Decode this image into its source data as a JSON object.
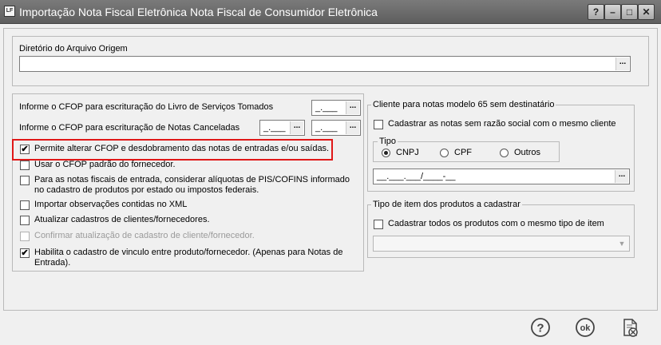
{
  "window": {
    "icon_label": "LF",
    "title": "Importação Nota Fiscal Eletrônica Nota Fiscal de Consumidor Eletrônica",
    "help_btn": "?",
    "minimize": "–",
    "maximize": "□",
    "close": "✕"
  },
  "origin": {
    "label": "Diretório do Arquivo Origem",
    "value": "",
    "browse": "..."
  },
  "cfop": {
    "servicos_label": "Informe o CFOP para escrituração do Livro de Serviços Tomados",
    "servicos_value": "_.___",
    "canceladas_label": "Informe o CFOP para escrituração de Notas Canceladas",
    "canceladas_value1": "_.___",
    "canceladas_value2": "_.___",
    "browse": "..."
  },
  "options": [
    {
      "label": "Permite alterar CFOP e desdobramento das notas de entradas e/ou saídas.",
      "checked": true,
      "disabled": false
    },
    {
      "label": "Usar o CFOP padrão do fornecedor.",
      "checked": false,
      "disabled": false
    },
    {
      "label": "Para as notas fiscais de entrada, considerar alíquotas de PIS/COFINS informado no cadastro de produtos por estado ou impostos federais.",
      "checked": false,
      "disabled": false
    },
    {
      "label": "Importar observações contidas no XML",
      "checked": false,
      "disabled": false
    },
    {
      "label": "Atualizar cadastros de clientes/fornecedores.",
      "checked": false,
      "disabled": false
    },
    {
      "label": "Confirmar atualização de cadastro de cliente/fornecedor.",
      "checked": false,
      "disabled": true
    },
    {
      "label": "Habilita o cadastro de vinculo entre produto/fornecedor.  (Apenas para Notas de Entrada).",
      "checked": true,
      "disabled": false
    }
  ],
  "cliente": {
    "group_label": "Cliente para notas modelo 65 sem destinatário",
    "check_label": "Cadastrar as notas sem razão social com o mesmo cliente",
    "tipo_label": "Tipo",
    "tipo_options": [
      "CNPJ",
      "CPF",
      "Outros"
    ],
    "tipo_selected": "CNPJ",
    "doc_value": "__.___.___/____-__",
    "browse": "..."
  },
  "produtos": {
    "group_label": "Tipo de item dos produtos a cadastrar",
    "check_label": "Cadastrar todos os produtos com o mesmo tipo de item",
    "combo_value": "",
    "combo_arrow": "▼"
  },
  "footer": {
    "help_icon": "help-icon",
    "ok_label": "ok",
    "cancel_icon": "cancel-icon"
  },
  "colors": {
    "highlight": "#e01818",
    "titlebar": "#6e6e6e"
  }
}
